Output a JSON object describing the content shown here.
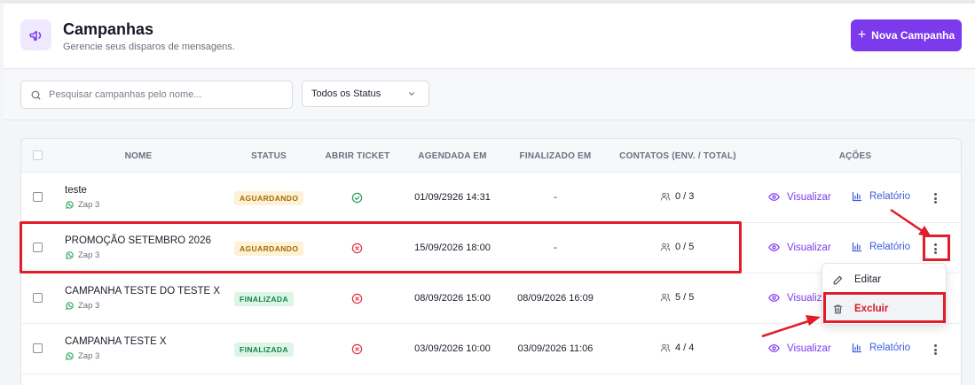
{
  "header": {
    "title": "Campanhas",
    "subtitle": "Gerencie seus disparos de mensagens.",
    "new_button_label": "Nova Campanha"
  },
  "filters": {
    "search_placeholder": "Pesquisar campanhas pelo nome...",
    "status_value": "Todos os Status"
  },
  "table": {
    "columns": {
      "name": "NOME",
      "status": "STATUS",
      "ticket": "ABRIR TICKET",
      "scheduled": "AGENDADA EM",
      "finished": "FINALIZADO EM",
      "contacts": "CONTATOS (ENV. / TOTAL)",
      "actions": "AÇÕES"
    },
    "view_label": "Visualizar",
    "report_label": "Relatório",
    "rows": [
      {
        "name": "teste",
        "connection": "Zap 3",
        "status": "AGUARDANDO",
        "ticket": "check",
        "scheduled": "01/09/2926 14:31",
        "finished": "-",
        "contacts": "0 / 3"
      },
      {
        "name": "PROMOÇÃO SETEMBRO 2026",
        "connection": "Zap 3",
        "status": "AGUARDANDO",
        "ticket": "x",
        "scheduled": "15/09/2026 18:00",
        "finished": "-",
        "contacts": "0 / 5"
      },
      {
        "name": "CAMPANHA TESTE DO TESTE X",
        "connection": "Zap 3",
        "status": "FINALIZADA",
        "ticket": "x",
        "scheduled": "08/09/2026 15:00",
        "finished": "08/09/2026 16:09",
        "contacts": "5 / 5"
      },
      {
        "name": "CAMPANHA TESTE X",
        "connection": "Zap 3",
        "status": "FINALIZADA",
        "ticket": "x",
        "scheduled": "03/09/2026 10:00",
        "finished": "03/09/2026 11:06",
        "contacts": "4 / 4"
      }
    ]
  },
  "menu": {
    "edit_label": "Editar",
    "delete_label": "Excluir"
  },
  "colors": {
    "accent": "#7c3aed",
    "annotation": "#e11d2a",
    "danger": "#d31b2b"
  }
}
